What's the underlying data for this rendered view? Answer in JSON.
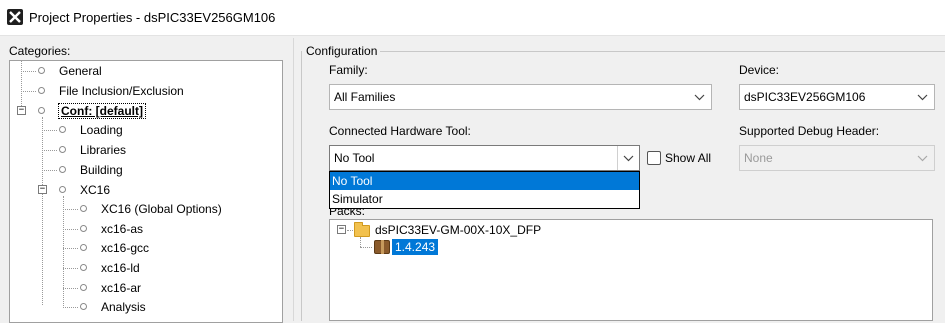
{
  "window": {
    "title": "Project Properties - dsPIC33EV256GM106"
  },
  "categories": {
    "label": "Categories:",
    "items": [
      {
        "label": "General"
      },
      {
        "label": "File Inclusion/Exclusion"
      },
      {
        "label": "Conf: [default]"
      },
      {
        "label": "Loading"
      },
      {
        "label": "Libraries"
      },
      {
        "label": "Building"
      },
      {
        "label": "XC16"
      },
      {
        "label": "XC16 (Global Options)"
      },
      {
        "label": "xc16-as"
      },
      {
        "label": "xc16-gcc"
      },
      {
        "label": "xc16-ld"
      },
      {
        "label": "xc16-ar"
      },
      {
        "label": "Analysis"
      }
    ]
  },
  "configuration": {
    "label": "Configuration",
    "family": {
      "label": "Family:",
      "value": "All Families"
    },
    "device": {
      "label": "Device:",
      "value": "dsPIC33EV256GM106"
    },
    "hardware_tool": {
      "label": "Connected Hardware Tool:",
      "value": "No Tool",
      "options": [
        "No Tool",
        "Simulator"
      ],
      "show_all_label": "Show All"
    },
    "debug_header": {
      "label": "Supported Debug Header:",
      "value": "None"
    },
    "packs": {
      "label": "Packs:",
      "pack_name": "dsPIC33EV-GM-00X-10X_DFP",
      "version": "1.4.243"
    }
  },
  "colors": {
    "selection": "#0078d7",
    "folder": "#f2c14e"
  },
  "icons": [
    "app-logo-icon",
    "chevron-down-icon",
    "folder-icon",
    "package-icon"
  ]
}
